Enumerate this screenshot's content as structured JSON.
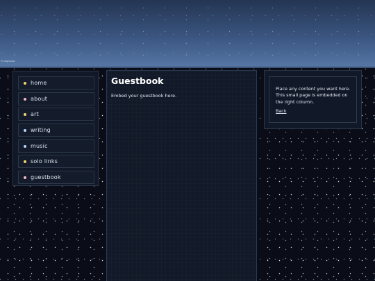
{
  "header": {
    "caption": "© blogmaster"
  },
  "sidebar": {
    "items": [
      {
        "label": "home",
        "dot_color": "#f4d27a"
      },
      {
        "label": "about",
        "dot_color": "#f2b9c8"
      },
      {
        "label": "art",
        "dot_color": "#f4d27a"
      },
      {
        "label": "writing",
        "dot_color": "#b9d4f2"
      },
      {
        "label": "music",
        "dot_color": "#b9d4f2"
      },
      {
        "label": "solo links",
        "dot_color": "#f4d27a"
      },
      {
        "label": "guestbook",
        "dot_color": "#f2b9c8"
      }
    ]
  },
  "main": {
    "title": "Guestbook",
    "text": "Embed your guestbook here."
  },
  "aside": {
    "text": "Place any content you want here. This small page is embedded on the right column.",
    "back_label": "Back"
  },
  "colors": {
    "background": "#0a0d17",
    "panel": "#111827",
    "panel_border": "#2a3648",
    "header_top": "#243552",
    "header_bottom": "#5676a4"
  }
}
